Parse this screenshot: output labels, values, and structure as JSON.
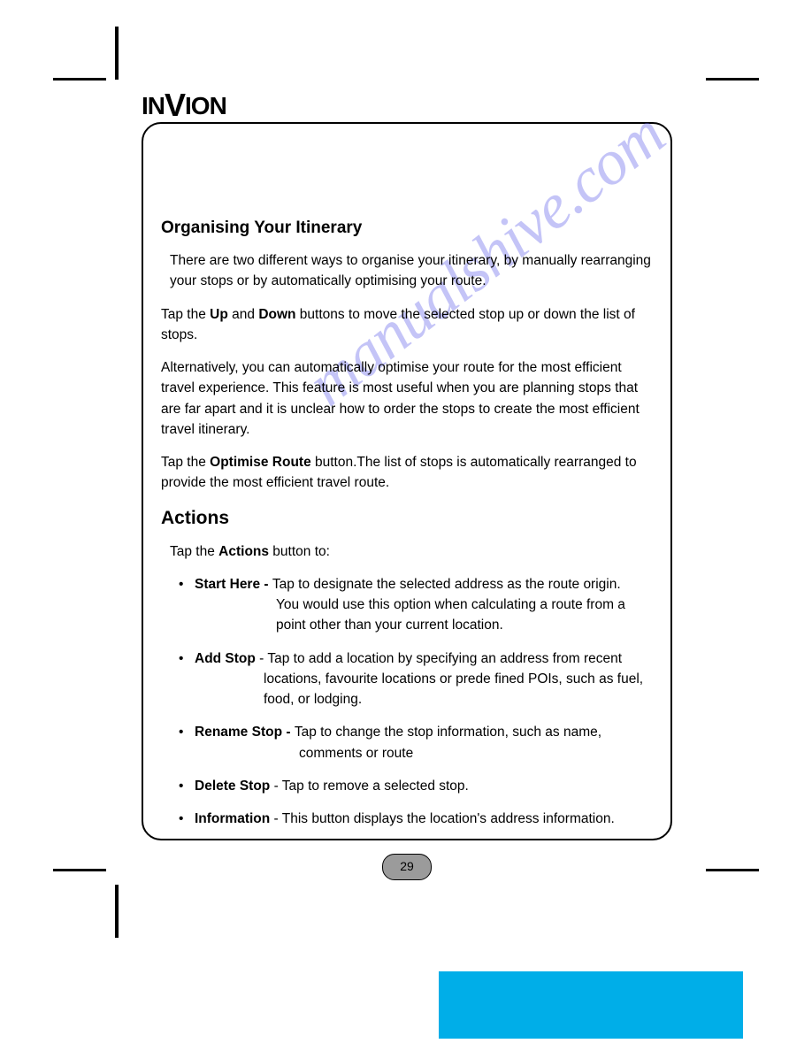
{
  "brand": {
    "pre": "IN",
    "big": "V",
    "post": "ION"
  },
  "watermark": "manualshive.com",
  "section1": {
    "heading": "Organising Your Itinerary",
    "p1": "There are two different ways to organise your itinerary, by manually rearranging your stops or by automatically optimising your route.",
    "p2_pre": "Tap the ",
    "p2_b1": "Up",
    "p2_mid": " and ",
    "p2_b2": "Down",
    "p2_post": " buttons to move the selected stop up or down the list of stops.",
    "p3": "Alternatively, you can automatically optimise your route for the most efficient travel experience. This feature is most useful when you are planning stops that are far apart and it is unclear how to order the stops to create the most efficient travel itinerary.",
    "p4_pre": "Tap the ",
    "p4_b": "Optimise Route",
    "p4_post": " button.The list of stops is automatically rearranged to provide the most efficient travel route."
  },
  "section2": {
    "heading": "Actions",
    "intro_pre": "Tap the ",
    "intro_b": "Actions",
    "intro_post": " button to:",
    "items": [
      {
        "label": "Start Here - ",
        "first": "Tap to designate the selected address as the route origin.",
        "rest": "You would use this option when calculating a route from a point other than your current location."
      },
      {
        "label": "Add Stop",
        "sep": " - ",
        "first": "Tap to add a location by specifying an address from recent",
        "rest": "locations, favourite locations or prede fined POIs, such as fuel, food, or lodging."
      },
      {
        "label": "Rename Stop - ",
        "first": "Tap to change the stop information, such as name,",
        "rest": "comments or route"
      },
      {
        "label": "Delete Stop",
        "sep": " - ",
        "first": "Tap to remove a selected stop.",
        "rest": ""
      },
      {
        "label": "Information",
        "sep": " - ",
        "first": "This button displays the location's address information.",
        "rest": ""
      }
    ]
  },
  "page_number": "29"
}
